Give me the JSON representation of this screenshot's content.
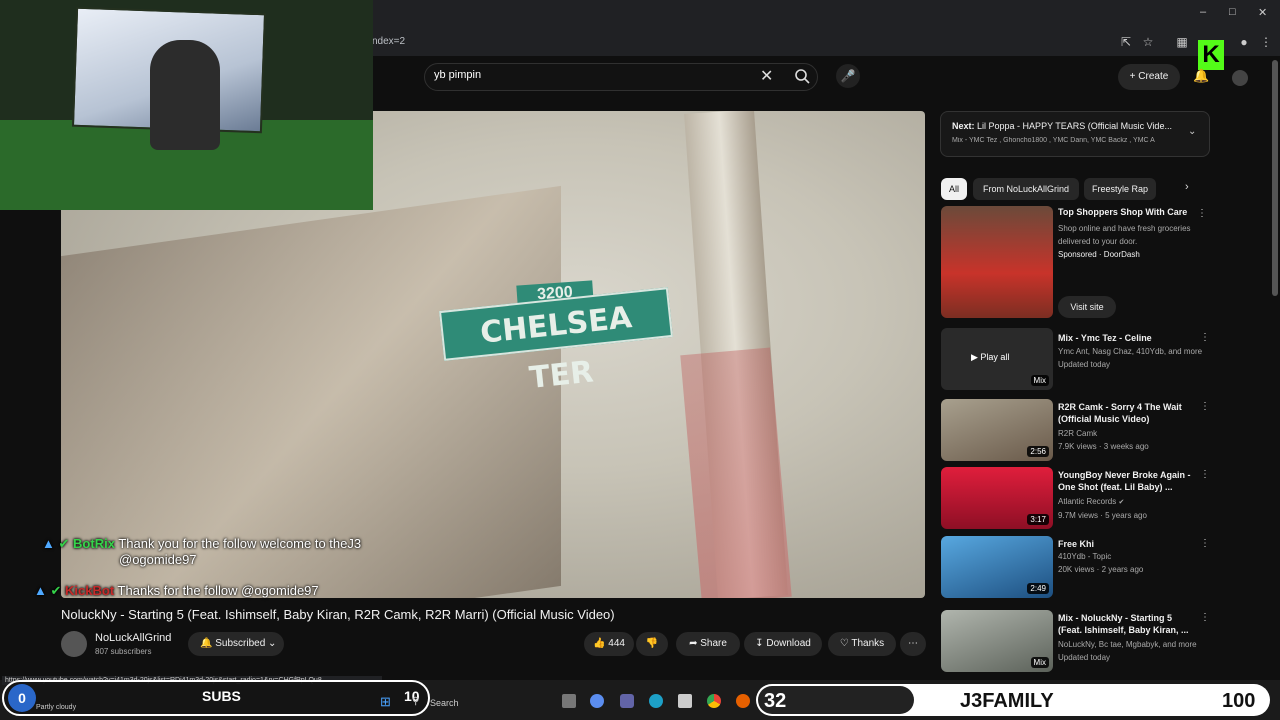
{
  "browser": {
    "url_fragment": "ndex=2",
    "status_url": "https://www.youtube.com/watch?v=i41m3d-20js&list=RDi41m3d-20js&start_radio=1&rv=CHGfPpLQu8"
  },
  "header": {
    "search_value": "yb pimpin",
    "create_label": "Create"
  },
  "video": {
    "sign_number": "3200",
    "sign_street": "CHELSEA TER",
    "title": "NoluckNy - Starting 5 (Feat. Ishimself, Baby Kiran, R2R Camk, R2R Marri) (Official Music Video)",
    "channel_name": "NoLuckAllGrind",
    "channel_subs": "807 subscribers",
    "subscribed_label": "Subscribed",
    "like_count": "444",
    "share_label": "Share",
    "download_label": "Download",
    "thanks_label": "Thanks"
  },
  "chat": [
    {
      "name": "BotRix",
      "name_color": "#35d34a",
      "message": "Thank you for the follow welcome to theJ3",
      "message2": "@ogomide97"
    },
    {
      "name": "KickBot",
      "name_color": "#c72a2a",
      "message": "Thanks for the follow @ogomide97",
      "message2": ""
    }
  ],
  "next": {
    "label": "Next:",
    "title": "Lil Poppa - HAPPY TEARS (Official Music Vide...",
    "sub": "Mix - YMC Tez , Ghoncho1800 , YMC Dann, YMC Backz , YMC A"
  },
  "chips": [
    "All",
    "From NoLuckAllGrind",
    "Freestyle Rap"
  ],
  "recommendations": [
    {
      "title": "Top Shoppers Shop With Care",
      "meta1": "Shop online and have fresh groceries",
      "meta2": "delivered to your door.",
      "meta3": "Sponsored · DoorDash",
      "cta": "Visit site",
      "duration": "",
      "thumb_color": "#c8332a"
    },
    {
      "title": "Mix - Ymc Tez - Celine",
      "meta1": "Ymc Ant, Nasg Chaz, 410Ydb, and more",
      "meta2": "Updated today",
      "meta3": "",
      "cta": "Play all",
      "duration": "Mix",
      "thumb_color": "#2a2a2a"
    },
    {
      "title": "R2R Camk - Sorry 4 The Wait (Official Music Video)",
      "meta1": "R2R Camk",
      "meta2": "7.9K views · 3 weeks ago",
      "meta3": "",
      "cta": "",
      "duration": "2:56",
      "thumb_color": "#7d7363"
    },
    {
      "title": "YoungBoy Never Broke Again - One Shot (feat. Lil Baby) ...",
      "meta1": "Atlantic Records",
      "meta2": "9.7M views · 5 years ago",
      "meta3": "",
      "cta": "",
      "duration": "3:17",
      "thumb_color": "#c2112f"
    },
    {
      "title": "Free Khi",
      "meta1": "410Ydb - Topic",
      "meta2": "20K views · 2 years ago",
      "meta3": "",
      "cta": "",
      "duration": "2:49",
      "thumb_color": "#3f8fc7"
    },
    {
      "title": "Mix - NoluckNy - Starting 5 (Feat. Ishimself, Baby Kiran, ...",
      "meta1": "NoLuckNy, Bc tae, Mgbabyk, and more",
      "meta2": "Updated today",
      "meta3": "",
      "cta": "",
      "duration": "Mix",
      "thumb_color": "#8a8f86"
    }
  ],
  "overlays": {
    "subs_label": "SUBS",
    "subs_count": "10",
    "subs_left": "0",
    "weather": "Partly cloudy",
    "taskbar_search": "Search",
    "family_count": "32",
    "family_label": "J3FAMILY",
    "family_goal": "100"
  }
}
